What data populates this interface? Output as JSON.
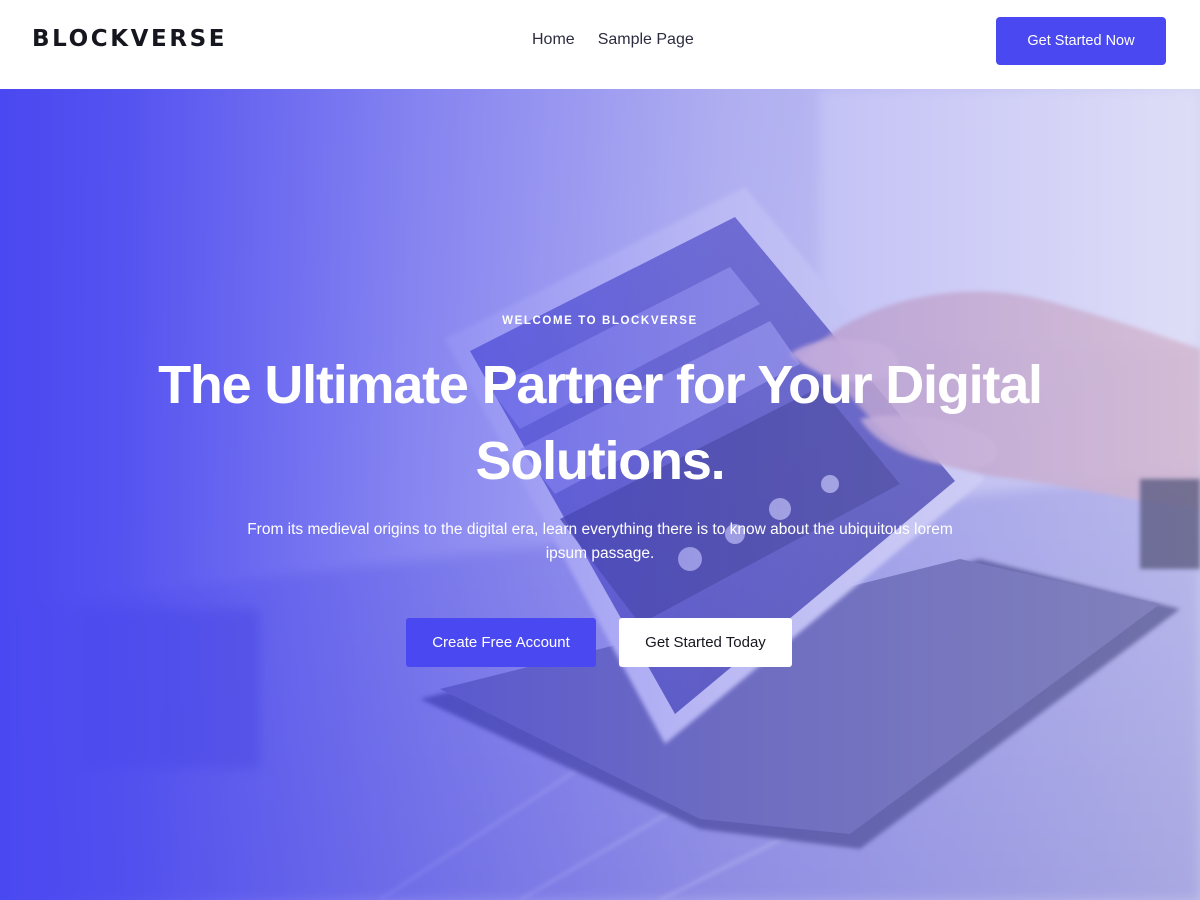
{
  "header": {
    "logo": "BLOCKVERSE",
    "nav": [
      {
        "label": "Home"
      },
      {
        "label": "Sample Page"
      }
    ],
    "cta_label": "Get Started Now"
  },
  "hero": {
    "eyebrow": "WELCOME TO BLOCKVERSE",
    "headline": "The Ultimate Partner for Your Digital Solutions.",
    "subtext": "From its medieval origins to the digital era, learn everything there is to know about the ubiquitous lorem ipsum passage.",
    "primary_button": "Create Free Account",
    "secondary_button": "Get Started Today",
    "background_image": "tablet-in-hand-photo"
  },
  "colors": {
    "accent": "#4a48f0",
    "text_dark": "#16161f",
    "white": "#ffffff"
  }
}
